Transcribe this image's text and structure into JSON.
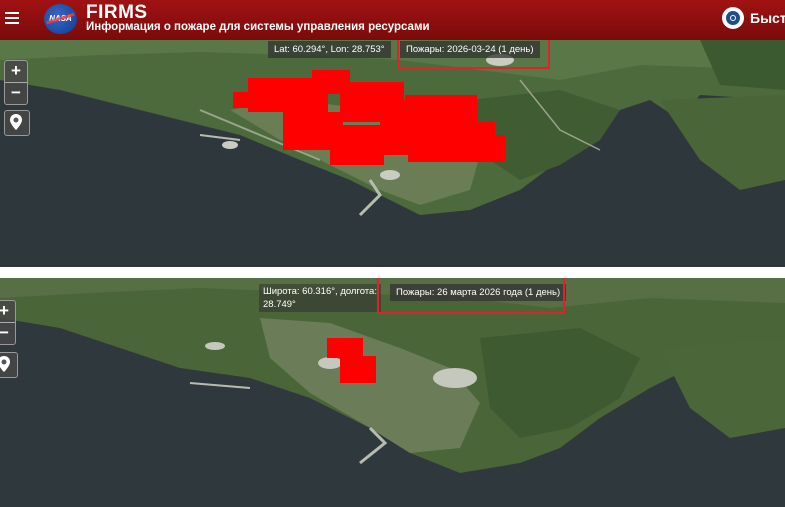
{
  "header": {
    "title": "FIRMS",
    "subtitle": "Информация о пожаре для системы управления ресурсами",
    "logo_text": "NASA",
    "search_label": "Быст"
  },
  "map_top": {
    "coords": "Lat: 60.294°, Lon: 28.753°",
    "fires": "Пожары: 2026-03-24 (1 день)",
    "zoom_in": "+",
    "zoom_out": "−"
  },
  "map_bottom": {
    "coords_line1": "Широта: 60.316°, долгота:",
    "coords_line2": "28.749°",
    "fires": "Пожары: 26 марта 2026 года (1 день)",
    "zoom_in": "+",
    "zoom_out": "−"
  },
  "colors": {
    "header": "#8e0f0f",
    "fire": "#ff0000",
    "highlight_box": "#e0222a",
    "water": "#2f3a40",
    "land": "#4c6b3a"
  },
  "icons": [
    "menu-icon",
    "nasa-logo",
    "search-icon",
    "zoom-in-icon",
    "zoom-out-icon",
    "location-pin-icon"
  ]
}
